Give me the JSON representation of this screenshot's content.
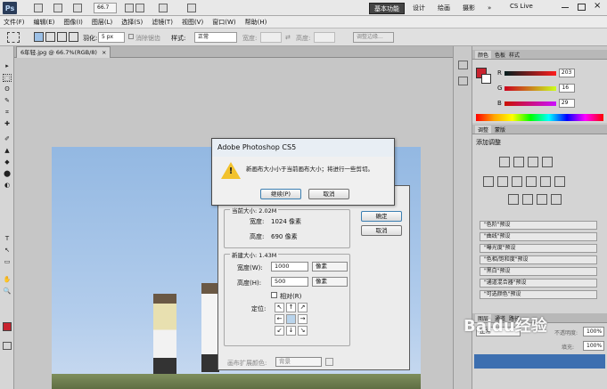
{
  "titlebar": {
    "logo": "Ps",
    "zoom": "66.7",
    "workspaces": [
      "基本功能",
      "设计",
      "绘画",
      "摄影"
    ],
    "active_workspace": "基本功能",
    "more": "»",
    "cs_live": "CS Live"
  },
  "menu": [
    "文件(F)",
    "编辑(E)",
    "图像(I)",
    "图层(L)",
    "选择(S)",
    "滤镜(T)",
    "视图(V)",
    "窗口(W)",
    "帮助(H)"
  ],
  "options": {
    "feather_label": "羽化:",
    "feather_value": "5 px",
    "antialias_label": "消除锯齿",
    "style_label": "样式:",
    "style_value": "正常",
    "width_label": "宽度:",
    "height_label": "高度:",
    "refine_edge": "调整边缘..."
  },
  "document_tab": "6年轻.jpg @ 66.7%(RGB/8)",
  "document_tab_close": "×",
  "color_panel": {
    "tabs": [
      "颜色",
      "色板",
      "样式"
    ],
    "r_label": "R",
    "g_label": "G",
    "b_label": "B",
    "r": "203",
    "g": "16",
    "b": "29"
  },
  "adjust_panel": {
    "tabs": [
      "调整",
      "蒙版"
    ],
    "title": "添加调整",
    "presets": [
      "\"色阶\"预设",
      "\"曲线\"预设",
      "\"曝光度\"预设",
      "\"色相/饱和度\"预设",
      "\"黑白\"预设",
      "\"通道混合器\"预设",
      "\"可选颜色\"预设"
    ]
  },
  "layers_panel": {
    "tabs": [
      "图层",
      "通道",
      "路径"
    ],
    "blend_mode": "正常",
    "opacity_label": "不透明度:",
    "opacity": "100%",
    "fill_label": "填充:",
    "fill": "100%"
  },
  "canvas_size_dialog": {
    "current_size_label": "当前大小: 2.02M",
    "width_label": "宽度:",
    "width_value": "1024 像素",
    "height_label": "高度:",
    "height_value": "690 像素",
    "new_size_label": "新建大小: 1.43M",
    "new_width_label": "宽度(W):",
    "new_width": "1000",
    "new_height_label": "高度(H):",
    "new_height": "500",
    "unit": "像素",
    "relative_label": "相对(R)",
    "anchor_label": "定位:",
    "ext_color_label": "画布扩展颜色:",
    "ext_color_value": "背景",
    "ok": "确定",
    "cancel": "取消",
    "anchor_arrows": [
      "↖",
      "↑",
      "↗",
      "←",
      "",
      "→",
      "↙",
      "↓",
      "↘"
    ]
  },
  "alert_dialog": {
    "title": "Adobe Photoshop CS5",
    "message": "新画布大小小于当前画布大小；将进行一些剪切。",
    "warn_mark": "!",
    "continue": "继续(P)",
    "cancel": "取消"
  },
  "tools": [
    "▸",
    "⬚",
    "ʘ",
    "✎",
    "⌗",
    "✚",
    "✐",
    "▲",
    "◆",
    "⬤",
    "◐",
    "T",
    "↖",
    "▭",
    "✋",
    "🔍"
  ],
  "watermark": "Baidu经验",
  "colors": {
    "foreground": "#c8232f",
    "background": "#ffffff"
  }
}
